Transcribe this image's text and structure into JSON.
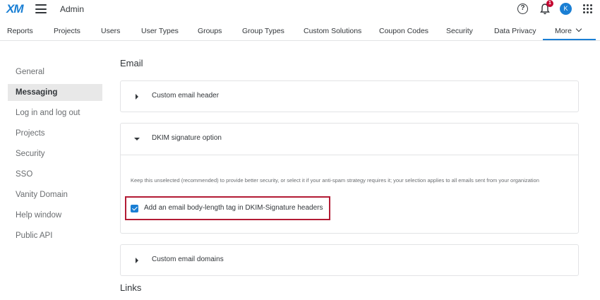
{
  "header": {
    "logo": "XM",
    "app_title": "Admin",
    "help_label": "?",
    "notification_count": "1",
    "avatar_initial": "K"
  },
  "nav": {
    "tabs": [
      "Reports",
      "Projects",
      "Users",
      "User Types",
      "Groups",
      "Group Types",
      "Custom Solutions",
      "Coupon Codes",
      "Security",
      "Data Privacy"
    ],
    "more_label": "More"
  },
  "sidebar": {
    "items": [
      "General",
      "Messaging",
      "Log in and log out",
      "Projects",
      "Security",
      "SSO",
      "Vanity Domain",
      "Help window",
      "Public API"
    ],
    "active": "Messaging"
  },
  "main": {
    "section_email": "Email",
    "cards": [
      {
        "title": "Custom email header",
        "expanded": false
      },
      {
        "title": "DKIM signature option",
        "expanded": true
      },
      {
        "title": "Custom email domains",
        "expanded": false
      }
    ],
    "dkim_description": "Keep this unselected (recommended) to provide better security, or select it if your anti-spam strategy requires it; your selection applies to all emails sent from your organization",
    "dkim_checkbox_label": "Add an email body-length tag in DKIM-Signature headers",
    "dkim_checkbox_checked": true,
    "section_links": "Links"
  },
  "colors": {
    "accent": "#1a7fd4",
    "highlight_border": "#b31b34",
    "badge": "#c4002f"
  }
}
